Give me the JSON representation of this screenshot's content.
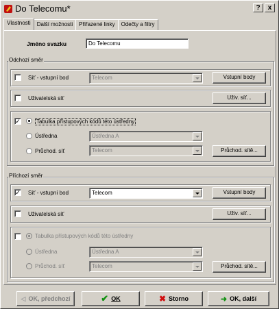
{
  "window": {
    "title": "Do Telecomu*",
    "help": "?",
    "close": "x"
  },
  "tabs": [
    "Vlastnosti",
    "Další možnosti",
    "Přiřazené linky",
    "Odečty a filtry"
  ],
  "name_label": "Jméno svazku",
  "name_value": "Do Telecomu",
  "outgoing": {
    "group_title": "Odchozí směr",
    "entry_label": "Síť - vstupní bod",
    "entry_value": "Telecom",
    "entry_button": "Vstupní body",
    "user_net_label": "Uživatelská síť",
    "user_net_button": "Uživ. síť...",
    "table_label": "Tabulka přístupových kódů této ústředny",
    "exchange_label": "Ústředna",
    "exchange_value": "Ústředna A",
    "transit_label": "Průchod. síť",
    "transit_value": "Telecom",
    "transit_button": "Průchod. sítě..."
  },
  "incoming": {
    "group_title": "Příchozí směr",
    "entry_label": "Síť - vstupní bod",
    "entry_value": "Telecom",
    "entry_button": "Vstupní body",
    "user_net_label": "Uživatelská síť",
    "user_net_button": "Uživ. síť...",
    "table_label": "Tabulka přístupových kódů této ústředny",
    "exchange_label": "Ústředna",
    "exchange_value": "Ústředna A",
    "transit_label": "Průchod. síť",
    "transit_value": "Telecom",
    "transit_button": "Průchod. sítě..."
  },
  "footer": {
    "prev": "OK, předchozí",
    "ok": "OK",
    "cancel": "Storno",
    "next": "OK, další"
  }
}
